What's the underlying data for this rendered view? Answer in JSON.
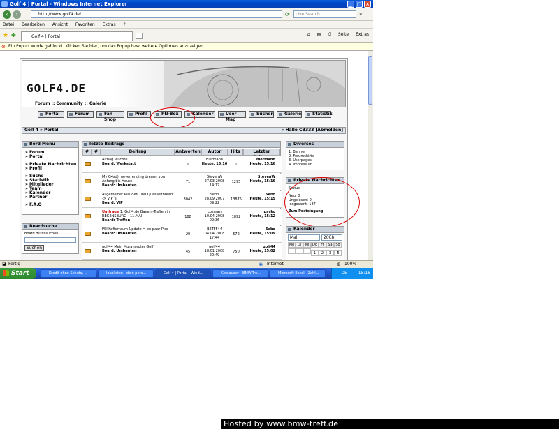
{
  "window": {
    "title": "Golf 4 | Portal - Windows Internet Explorer"
  },
  "address": {
    "url": "http://www.golf4.de/",
    "search_placeholder": "Live Search"
  },
  "menu": [
    "Datei",
    "Bearbeiten",
    "Ansicht",
    "Favoriten",
    "Extras",
    "?"
  ],
  "tab": {
    "title": "Golf 4 | Portal"
  },
  "toolbar": {
    "page": "Seite",
    "extras": "Extras"
  },
  "infobar": {
    "text": "Ein Popup wurde geblockt. Klicken Sie hier, um das Popup bzw. weitere Optionen anzuzeigen..."
  },
  "site": {
    "logo": "GOLF4.DE",
    "tagline": "Forum :: Community :: Galerie",
    "nav": [
      "Portal",
      "Forum",
      "Fan Shop",
      "Profil",
      "PN-Box",
      "Kalender",
      "User Map",
      "Suchen",
      "Galerie",
      "Statistik"
    ],
    "breadcrumb": "Golf 4 » Portal",
    "greeting": "» Hallo CB333 [Abmelden]"
  },
  "board_menu": {
    "title": "Bord Menü",
    "groups": [
      [
        "Forum",
        "Portal"
      ],
      [
        "Private Nachrichten",
        "Profil"
      ],
      [
        "Suche",
        "Statistik",
        "Mitglieder",
        "Team",
        "Kalender",
        "Partner"
      ],
      [
        "F.A.Q"
      ]
    ]
  },
  "board_search": {
    "title": "Boardsuche",
    "label": "Board durchsuchen:",
    "button": "Suchen"
  },
  "posts": {
    "title": "letzte Beiträge",
    "headers": [
      "#",
      "#",
      "Beitrag",
      "Antworten",
      "Autor",
      "Hits",
      "Letzter Beitrag"
    ],
    "rows": [
      {
        "topic": "Airbag leuchte",
        "board": "Board: Werkstatt",
        "answers": "0",
        "author": "Biermann",
        "date": "Heute, 15:16",
        "hits": "1",
        "last_user": "Biermann",
        "last_date": "Heute, 15:16",
        "umfrage": ""
      },
      {
        "topic": "My G4sd), never ending dream, von Anfang bis Heute",
        "board": "Board: Umbauten",
        "answers": "71",
        "author": "StevenW",
        "date": "27.03.2008 14:17",
        "hits": "1295",
        "last_user": "StevenW",
        "last_date": "Heute, 15:16",
        "umfrage": ""
      },
      {
        "topic": "Allgemeiner Plauder- und Quasselthread -> VIP´s",
        "board": "Board: VIP",
        "answers": "3042",
        "author": "Sebo",
        "date": "28.09.2007 09:22",
        "hits": "13875",
        "last_user": "Sebo",
        "last_date": "Heute, 15:15",
        "umfrage": ""
      },
      {
        "topic": "1. Golf4.de Bayern-Treffen in REGENSBURG - 11.MAI",
        "board": "Board: Treffen",
        "answers": "188",
        "author": "cosman",
        "date": "10.04.2008 09:36",
        "hits": "1892",
        "last_user": "psyko",
        "last_date": "Heute, 15:12",
        "umfrage": "Umfrage"
      },
      {
        "topic": "PSI Kofferraum Update = en paar Pics",
        "board": "Board: Umbauten",
        "answers": "29",
        "author": "B2TFF44",
        "date": "04.04.2008 17:44",
        "hits": "572",
        "last_user": "Sebo",
        "last_date": "Heute, 15:09",
        "umfrage": ""
      },
      {
        "topic": "golf44 Mein Muranoroter Golf",
        "board": "Board: Umbauten",
        "answers": "45",
        "author": "golf44",
        "date": "18.01.2008 20:49",
        "hits": "750",
        "last_user": "golf44",
        "last_date": "Heute, 15:02",
        "umfrage": ""
      }
    ]
  },
  "diverses": {
    "title": "Diverses",
    "items": [
      "1. Banner",
      "2. Forumshirts",
      "3. Userpages",
      "4. Impressum"
    ]
  },
  "pm": {
    "title": "Private Nachrichten",
    "status": "Status:",
    "neu": "Neu: 0",
    "ungelesen": "Ungelesen: 0",
    "insgesamt": "Insgesamt: 187",
    "link": "Zum Posteingang"
  },
  "calendar": {
    "title": "Kalender",
    "month": "Mai",
    "year": "2008",
    "days": [
      "Mo",
      "Di",
      "Mi",
      "Do",
      "Fr",
      "Sa",
      "So"
    ],
    "row1": [
      "",
      "",
      "",
      "1",
      "2",
      "3",
      "4"
    ]
  },
  "status": {
    "left": "Fertig",
    "zone": "Internet",
    "zoom": "100%"
  },
  "taskbar": {
    "start": "Start",
    "items": [
      "Kredit ohne Schufa, ...",
      "lokalisten - dein pers...",
      "Golf 4 | Portal - Wind...",
      "Geplauder - BMW-Tre...",
      "Microsoft Excel - Zahl..."
    ],
    "lang": "DE",
    "time": "15:16"
  },
  "hosted": "Hosted by www.bmw-treff.de"
}
